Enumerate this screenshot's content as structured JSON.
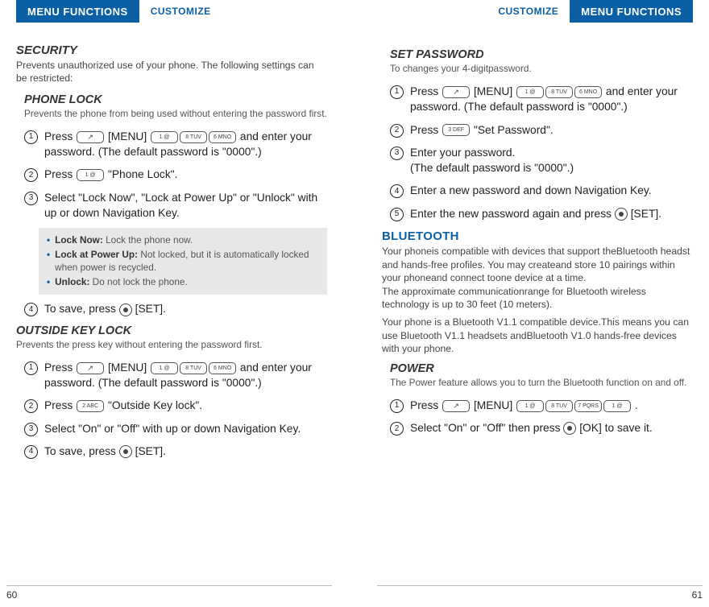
{
  "header": {
    "menu_functions": "MENU FUNCTIONS",
    "customize": "CUSTOMIZE"
  },
  "keys": {
    "one": "1 @",
    "two": "2 ABC",
    "three": "3 DEF",
    "six": "6 MNO",
    "seven": "7 PQRS",
    "eight": "8 TUV"
  },
  "left": {
    "security": {
      "title": "SECURITY",
      "desc": "Prevents unauthorized use of your phone. The following settings can be restricted:"
    },
    "phonelock": {
      "title": "PHONE LOCK",
      "desc": "Prevents the phone from being used without entering the password first.",
      "s1a": "Press ",
      "s1b": " [MENU] ",
      "s1c": " and enter your password. (The default password is \"0000\".)",
      "s2a": "Press ",
      "s2b": " \"Phone Lock\".",
      "s3": "Select \"Lock Now\", \"Lock at Power Up\" or \"Unlock\" with up or down Navigation Key.",
      "call_lock_now_l": "Lock Now:",
      "call_lock_now_t": " Lock the phone now.",
      "call_lock_pu_l": "Lock at Power Up:",
      "call_lock_pu_t": " Not locked, but it is automatically locked when power is recycled.",
      "call_unlock_l": "Unlock:",
      "call_unlock_t": " Do not lock the phone.",
      "s4a": "To save, press ",
      "s4b": " [SET]."
    },
    "okl": {
      "title": "OUTSIDE KEY LOCK",
      "desc": "Prevents the press key without entering the password first.",
      "s1a": "Press ",
      "s1b": " [MENU] ",
      "s1c": " and enter your password. (The default password is \"0000\".)",
      "s2a": "Press ",
      "s2b": " \"Outside Key lock\".",
      "s3": "Select \"On\" or \"Off\" with up or down Navigation Key.",
      "s4a": "To save, press ",
      "s4b": " [SET]."
    },
    "page_num": "60"
  },
  "right": {
    "setpw": {
      "title": "SET PASSWORD",
      "desc": "To changes your 4-digitpassword.",
      "s1a": "Press ",
      "s1b": " [MENU] ",
      "s1c": " and enter your password. (The default password is \"0000\".)",
      "s2a": "Press ",
      "s2b": " \"Set Password\".",
      "s3a": "Enter your password.",
      "s3b": "(The default password is \"0000\".)",
      "s4": "Enter a new password and down Navigation Key.",
      "s5a": "Enter the new password again and press ",
      "s5b": " [SET]."
    },
    "bt": {
      "title": "BLUETOOTH",
      "p1": "Your phoneis compatible with devices that support theBluetooth headst and hands-free profiles. You may createand store 10 pairings within your phoneand connect toone device at a time.",
      "p2": "The approximate communicationrange for Bluetooth wireless technology is up to 30 feet (10 meters).",
      "p3": "Your phone is a Bluetooth V1.1 compatible device.This means you can use Bluetooth V1.1 headsets andBluetooth V1.0 hands-free devices with your phone."
    },
    "power": {
      "title": "POWER",
      "desc": "The Power feature allows you to turn the Bluetooth function on and off.",
      "s1a": "Press ",
      "s1b": " [MENU] ",
      "s1c": " .",
      "s2a": "Select \"On\" or \"Off\" then press ",
      "s2b": " [OK] to save it."
    },
    "page_num": "61"
  }
}
